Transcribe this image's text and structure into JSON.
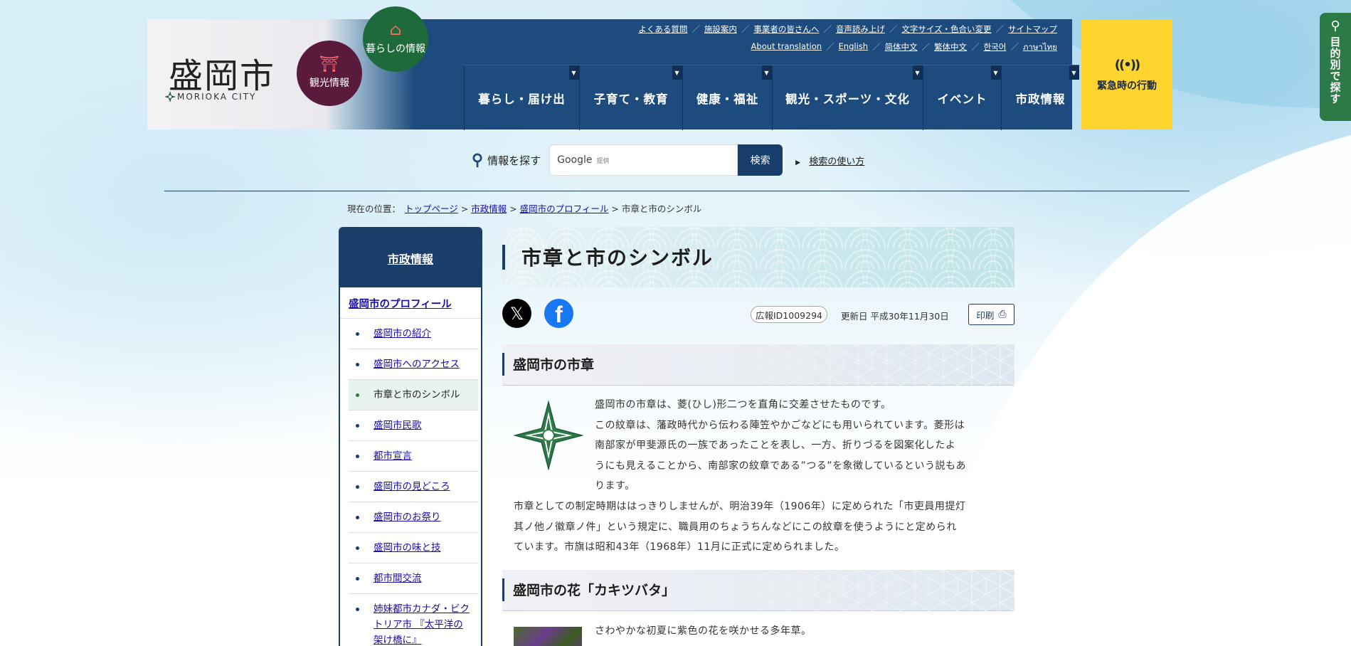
{
  "site": {
    "logo_title": "盛岡市",
    "logo_sub": "MORIOKA CITY",
    "circle_kanko": "観光情報",
    "circle_kurashi": "暮らしの情報"
  },
  "top_links_row1": [
    "よくある質問",
    "施設案内",
    "事業者の皆さんへ",
    "音声読み上げ",
    "文字サイズ・色合い変更",
    "サイトマップ"
  ],
  "top_links_row2": [
    "About translation",
    "English",
    "简体中文",
    "繁体中文",
    "한국어",
    "ภาษาไทย"
  ],
  "main_nav": [
    "暮らし・届け出",
    "子育て・教育",
    "健康・福祉",
    "観光・スポーツ・文化",
    "イベント",
    "市政情報"
  ],
  "emergency_label": "緊急時の行動",
  "side_tab_label": "目的別で探す",
  "search": {
    "label": "情報を探す",
    "placeholder_brand": "Google",
    "placeholder_powered": "提供",
    "button": "検索",
    "help": "検索の使い方"
  },
  "breadcrumb": {
    "prefix": "現在の位置：",
    "items": [
      "トップページ",
      "市政情報",
      "盛岡市のプロフィール"
    ],
    "current": "市章と市のシンボル",
    "sep": " > "
  },
  "sidebar": {
    "heading": "市政情報",
    "section": "盛岡市のプロフィール",
    "items": [
      {
        "label": "盛岡市の紹介",
        "current": false
      },
      {
        "label": "盛岡市へのアクセス",
        "current": false
      },
      {
        "label": "市章と市のシンボル",
        "current": true
      },
      {
        "label": "盛岡市民歌",
        "current": false
      },
      {
        "label": "都市宣言",
        "current": false
      },
      {
        "label": "盛岡市の見どころ",
        "current": false
      },
      {
        "label": "盛岡市のお祭り",
        "current": false
      },
      {
        "label": "盛岡市の味と技",
        "current": false
      },
      {
        "label": "都市間交流",
        "current": false
      },
      {
        "label": "姉妹都市カナダ・ビクトリア市 『太平洋の架け橋に』",
        "current": false
      }
    ]
  },
  "page": {
    "title": "市章と市のシンボル",
    "id_badge": "広報ID1009294",
    "updated": "更新日 平成30年11月30日",
    "print": "印刷",
    "sections": [
      {
        "heading": "盛岡市の市章",
        "text_wrap": [
          "盛岡市の市章は、菱(ひし)形二つを直角に交差させたものです。",
          "この紋章は、藩政時代から伝わる陣笠やかごなどにも用いられています。菱形は",
          "南部家が甲斐源氏の一族であったことを表し、一方、折りづるを図案化したよ",
          "うにも見えることから、南部家の紋章である”つる”を象徴しているという説もあ",
          "ります。"
        ],
        "text_full": [
          "市章としての制定時期ははっきりしませんが、明治39年（1906年）に定められた「市吏員用提灯",
          "其ノ他ノ徽章ノ件」という規定に、職員用のちょうちんなどにこの紋章を使うようにと定められ",
          "ています。市旗は昭和43年（1968年）11月に正式に定められました。"
        ]
      },
      {
        "heading": "盛岡市の花「カキツバタ」",
        "text_wrap": [
          "さわやかな初夏に紫色の花を咲かせる多年草。"
        ]
      }
    ]
  },
  "colors": {
    "navy": "#1d4b7d",
    "emergency_yellow": "#fed52f",
    "green_tab": "#2c7a46",
    "kanko_circle": "#5a1a3c",
    "kurashi_circle": "#1f6a3a"
  }
}
